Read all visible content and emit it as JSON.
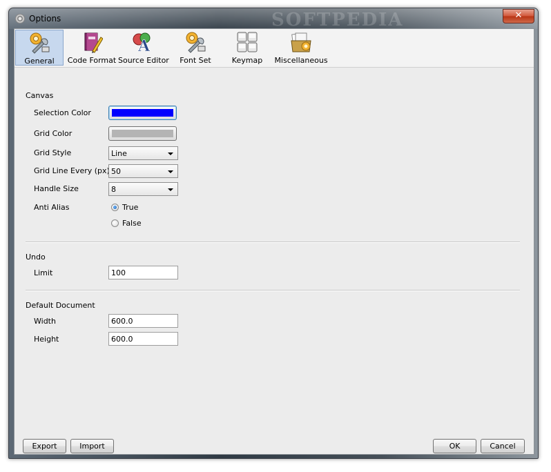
{
  "window": {
    "title": "Options",
    "close_glyph": "✕",
    "watermark": "SOFTPEDIA"
  },
  "toolbar": {
    "items": [
      {
        "label": "General",
        "icon": "wrench-gear-icon",
        "selected": true
      },
      {
        "label": "Code Format",
        "icon": "book-pencil-icon"
      },
      {
        "label": "Source Editor",
        "icon": "font-editor-icon"
      },
      {
        "label": "Font Set",
        "icon": "wrench-gear-icon"
      },
      {
        "label": "Keymap",
        "icon": "keyboard-icon"
      },
      {
        "label": "Miscellaneous",
        "icon": "folder-gear-icon"
      }
    ]
  },
  "canvas": {
    "title": "Canvas",
    "selection_color_label": "Selection Color",
    "selection_color": "#0000ff",
    "grid_color_label": "Grid Color",
    "grid_color": "#b4b4b4",
    "grid_style_label": "Grid Style",
    "grid_style_value": "Line",
    "grid_line_every_label": "Grid Line Every (px)",
    "grid_line_every_value": "50",
    "handle_size_label": "Handle Size",
    "handle_size_value": "8",
    "anti_alias_label": "Anti Alias",
    "anti_alias_true": "True",
    "anti_alias_false": "False",
    "anti_alias_selected": "True"
  },
  "undo": {
    "title": "Undo",
    "limit_label": "Limit",
    "limit_value": "100"
  },
  "default_document": {
    "title": "Default Document",
    "width_label": "Width",
    "width_value": "600.0",
    "height_label": "Height",
    "height_value": "600.0"
  },
  "buttons": {
    "export": "Export",
    "import": "Import",
    "ok": "OK",
    "cancel": "Cancel"
  }
}
